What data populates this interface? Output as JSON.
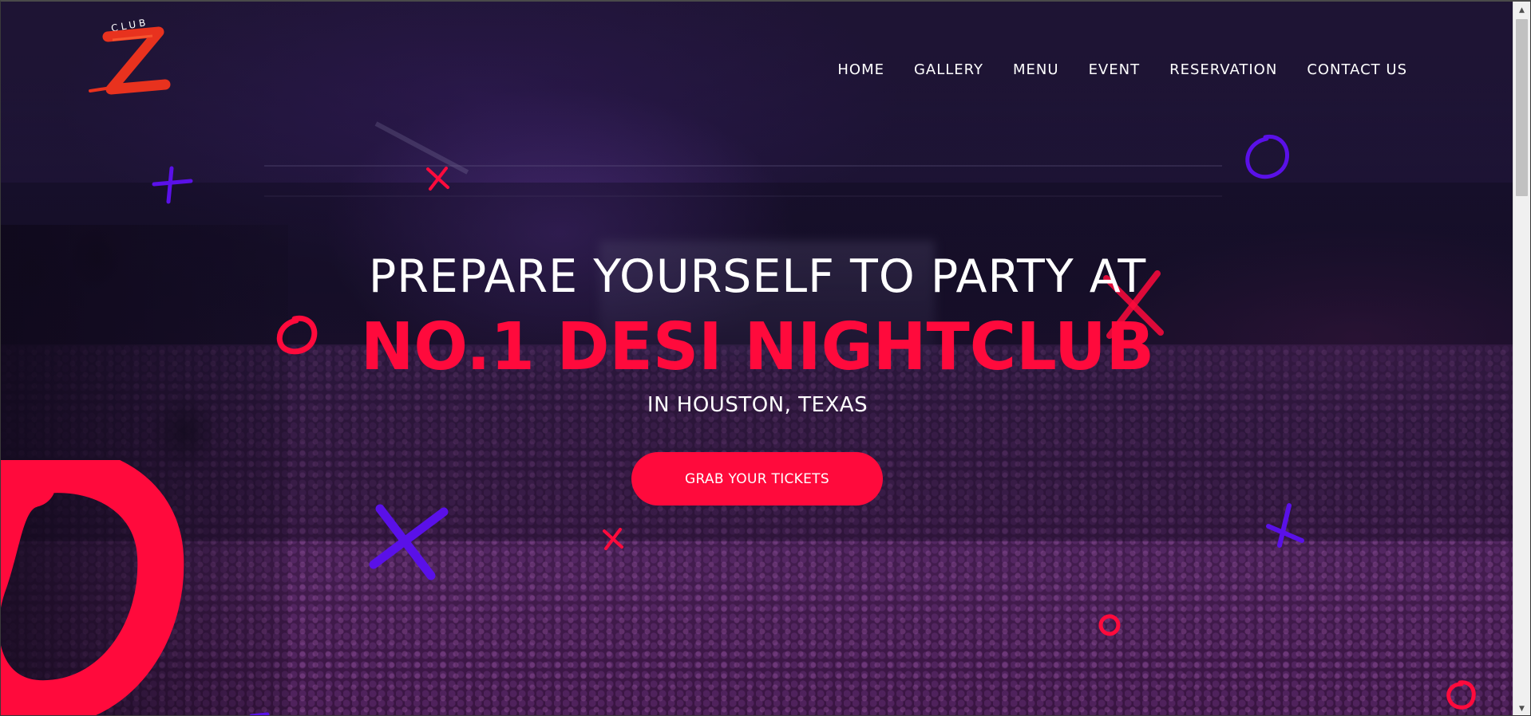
{
  "brand": {
    "logo_small_text": "CLUB",
    "logo_letter": "Z"
  },
  "nav": {
    "items": [
      {
        "label": "HOME"
      },
      {
        "label": "GALLERY"
      },
      {
        "label": "MENU"
      },
      {
        "label": "EVENT"
      },
      {
        "label": "RESERVATION"
      },
      {
        "label": "CONTACT US"
      }
    ]
  },
  "hero": {
    "headline": "PREPARE YOURSELF TO PARTY AT",
    "title": "NO.1 DESI NIGHTCLUB",
    "location": "IN HOUSTON, TEXAS",
    "cta_label": "GRAB YOUR TICKETS"
  },
  "colors": {
    "accent_red": "#ff0a3c",
    "doodle_purple": "#5a10e8",
    "text_white": "#ffffff"
  },
  "icons": {
    "scroll_up": "▲",
    "scroll_down": "▼"
  }
}
